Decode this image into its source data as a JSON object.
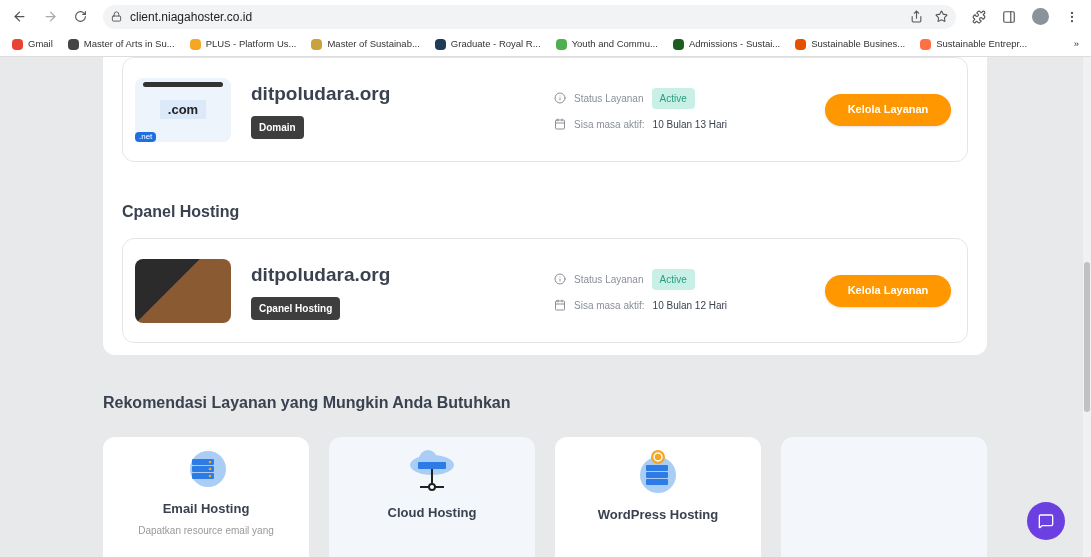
{
  "browser": {
    "url": "client.niagahoster.co.id",
    "bookmarks": [
      {
        "label": "Gmail",
        "color": "#ea4335"
      },
      {
        "label": "Master of Arts in Su...",
        "color": "#444444"
      },
      {
        "label": "PLUS - Platform Us...",
        "color": "#f5a623"
      },
      {
        "label": "Master of Sustainab...",
        "color": "#c8a23c"
      },
      {
        "label": "Graduate - Royal R...",
        "color": "#1f3b57"
      },
      {
        "label": "Youth and Commu...",
        "color": "#4caf50"
      },
      {
        "label": "Admissions - Sustai...",
        "color": "#1b5e20"
      },
      {
        "label": "Sustainable Busines...",
        "color": "#e65100"
      },
      {
        "label": "Sustainable Entrepr...",
        "color": "#ff7043"
      }
    ],
    "more": "»"
  },
  "sections": [
    {
      "service": {
        "kind": "domain",
        "name": "ditpoludara.org",
        "tag": "Domain",
        "status_label": "Status Layanan",
        "status": "Active",
        "period_label": "Sisa masa aktif:",
        "period": "10 Bulan 13 Hari",
        "image_text": ".com",
        "image_badge": ".net",
        "button": "Kelola Layanan"
      }
    },
    {
      "heading": "Cpanel Hosting",
      "service": {
        "kind": "hosting",
        "name": "ditpoludara.org",
        "tag": "Cpanel Hosting",
        "status_label": "Status Layanan",
        "status": "Active",
        "period_label": "Sisa masa aktif:",
        "period": "10 Bulan 12 Hari",
        "button": "Kelola Layanan"
      }
    }
  ],
  "recommendations": {
    "heading": "Rekomendasi Layanan yang Mungkin Anda Butuhkan",
    "cards": [
      {
        "kind": "email",
        "title": "Email Hosting",
        "description": "Dapatkan resource email yang"
      },
      {
        "kind": "cloud",
        "title": "Cloud Hosting"
      },
      {
        "kind": "wordpress",
        "title": "WordPress Hosting"
      },
      {
        "kind": "empty"
      }
    ]
  }
}
